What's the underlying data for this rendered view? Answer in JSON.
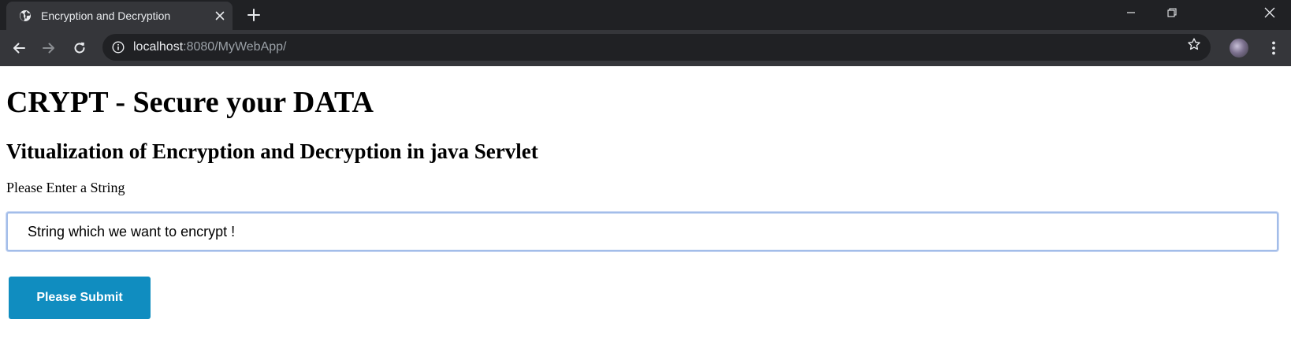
{
  "browser": {
    "tab": {
      "title": "Encryption and Decryption",
      "favicon": "globe-icon",
      "close_icon": "close-icon"
    },
    "new_tab_icon": "plus-icon",
    "window_controls": [
      "minimize-icon",
      "restore-icon",
      "close-icon"
    ],
    "address_bar": {
      "host": "localhost",
      "rest": ":8080/MyWebApp/",
      "info_icon": "info-icon"
    },
    "toolbar_icons": [
      "back-arrow-icon",
      "forward-arrow-icon",
      "reload-icon",
      "star-icon",
      "avatar",
      "kebab-menu-icon"
    ]
  },
  "page": {
    "heading": "CRYPT - Secure your DATA",
    "subheading": "Vitualization of Encryption and Decryption in java Servlet",
    "form": {
      "label": "Please Enter a String",
      "input_value": "String which we want to encrypt !",
      "submit_label": "Please Submit"
    }
  },
  "colors": {
    "tabstrip_bg": "#202124",
    "toolbar_bg": "#35363a",
    "button_bg": "#108dc0",
    "input_focus_border": "#a3bde9"
  }
}
